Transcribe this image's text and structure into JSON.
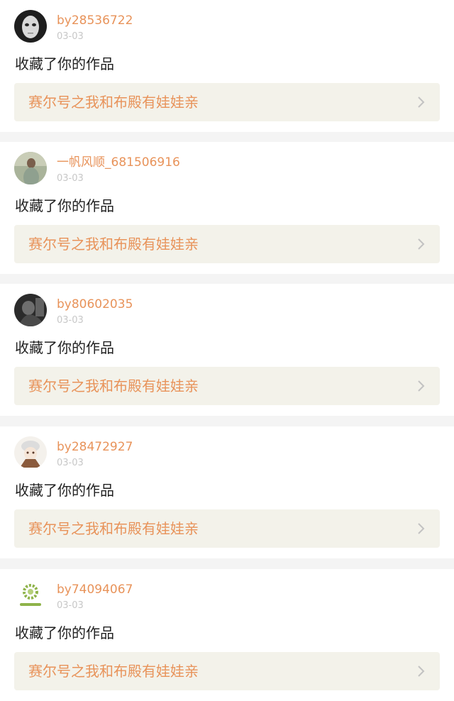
{
  "feed": {
    "items": [
      {
        "username": "by28536722",
        "timestamp": "03-03",
        "action": "收藏了你的作品",
        "work_title": "赛尔号之我和布殿有娃娃亲",
        "avatar_icon": "white-mask-avatar"
      },
      {
        "username": "一帆风顺_681506916",
        "timestamp": "03-03",
        "action": "收藏了你的作品",
        "work_title": "赛尔号之我和布殿有娃娃亲",
        "avatar_icon": "girl-photo-avatar"
      },
      {
        "username": "by80602035",
        "timestamp": "03-03",
        "action": "收藏了你的作品",
        "work_title": "赛尔号之我和布殿有娃娃亲",
        "avatar_icon": "dark-portrait-avatar"
      },
      {
        "username": "by28472927",
        "timestamp": "03-03",
        "action": "收藏了你的作品",
        "work_title": "赛尔号之我和布殿有娃娃亲",
        "avatar_icon": "anime-character-avatar"
      },
      {
        "username": "by74094067",
        "timestamp": "03-03",
        "action": "收藏了你的作品",
        "work_title": "赛尔号之我和布殿有娃娃亲",
        "avatar_icon": "green-sun-logo-avatar"
      }
    ]
  },
  "colors": {
    "accent": "#e8935a",
    "timestamp": "#c7c7c7",
    "work_link_bg": "#f3f2ea",
    "page_bg": "#f4f4f4"
  }
}
